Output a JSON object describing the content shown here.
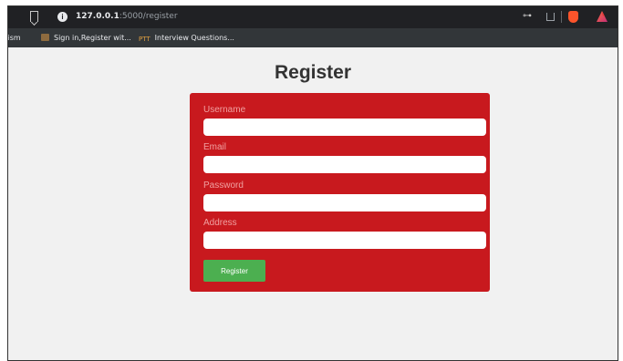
{
  "browser": {
    "url_host": "127.0.0.1",
    "url_rest": ":5000/register",
    "bookmarks": [
      {
        "label": "rcism"
      },
      {
        "label": "Sign in,Register wit..."
      },
      {
        "label": "Interview Questions..."
      }
    ],
    "bookmark_icon_text": "PTT"
  },
  "page": {
    "title": "Register"
  },
  "form": {
    "username_label": "Username",
    "email_label": "Email",
    "password_label": "Password",
    "address_label": "Address",
    "username_value": "",
    "email_value": "",
    "password_value": "",
    "address_value": "",
    "submit_label": "Register"
  },
  "colors": {
    "card_bg": "#c8191e",
    "submit_bg": "#4caf50",
    "page_bg": "#f1f1f1"
  }
}
